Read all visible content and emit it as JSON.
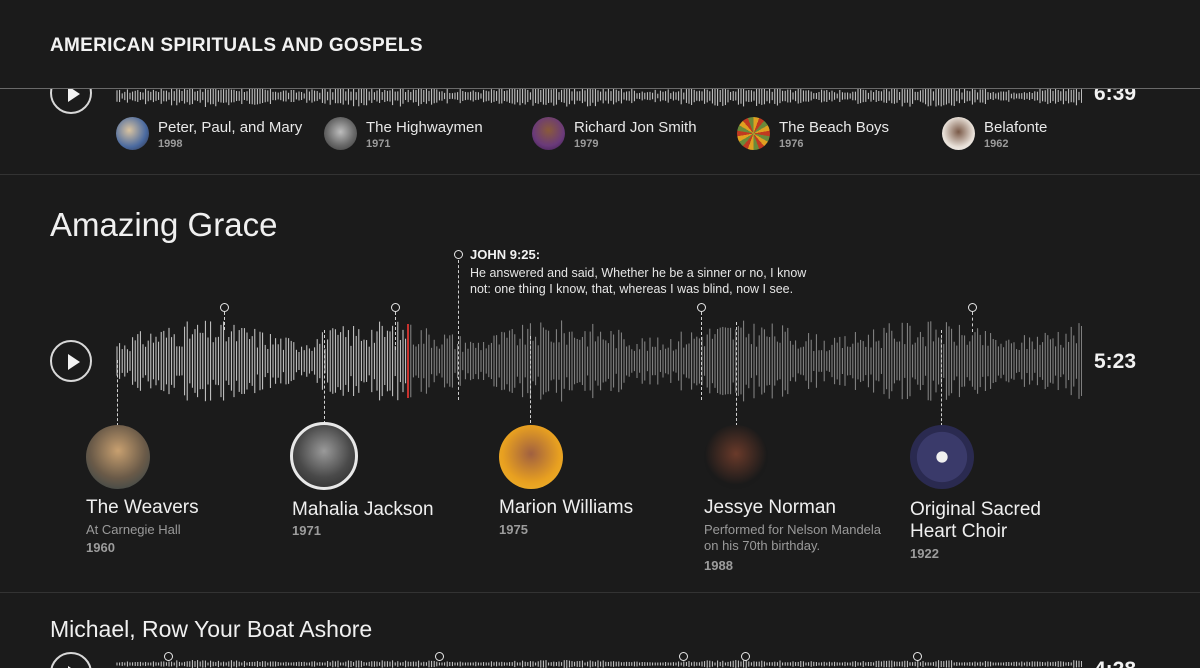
{
  "header": {
    "title": "AMERICAN SPIRITUALS AND GOSPELS"
  },
  "colors": {
    "background": "#1b1b1b",
    "accent_playhead": "#c8322e",
    "text": "#e8e8e8",
    "muted": "#9c9c9c"
  },
  "top_track": {
    "duration": "6:39",
    "artists": [
      {
        "name": "Peter, Paul, and Mary",
        "year": "1998"
      },
      {
        "name": "The Highwaymen",
        "year": "1971"
      },
      {
        "name": "Richard Jon Smith",
        "year": "1979"
      },
      {
        "name": "The Beach Boys",
        "year": "1976"
      },
      {
        "name": "Belafonte",
        "year": "1962"
      }
    ]
  },
  "main_track": {
    "title": "Amazing Grace",
    "duration": "5:23",
    "verse": {
      "reference": "JOHN 9:25:",
      "text": "He answered and said, Whether he be a sinner or no, I know not: one thing I know, that, whereas I was blind, now I see."
    },
    "artists": [
      {
        "name": "The Weavers",
        "note": "At Carnegie Hall",
        "year": "1960"
      },
      {
        "name": "Mahalia Jackson",
        "note": "",
        "year": "1971"
      },
      {
        "name": "Marion Williams",
        "note": "",
        "year": "1975"
      },
      {
        "name": "Jessye Norman",
        "note": "Performed for Nelson Mandela on his 70th birthday.",
        "year": "1988"
      },
      {
        "name": "Original Sacred Heart Choir",
        "note": "",
        "year": "1922"
      }
    ]
  },
  "bottom_track": {
    "title": "Michael, Row Your Boat Ashore",
    "duration": "4:28"
  }
}
